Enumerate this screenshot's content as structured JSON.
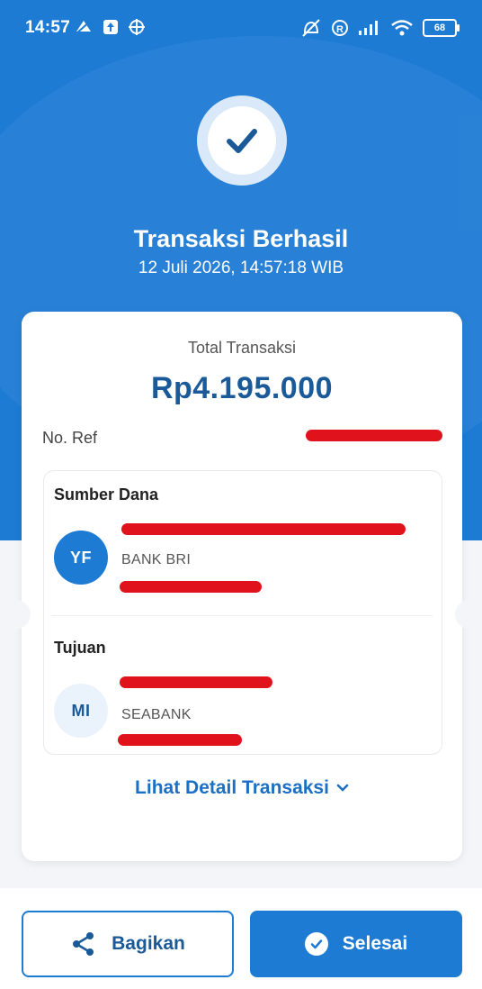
{
  "status_bar": {
    "time": "14:57",
    "battery": "68",
    "left_icons": [
      "notification-mute-icon",
      "upload-icon",
      "vpn-icon"
    ],
    "right_icons": [
      "mute-icon",
      "registered-icon",
      "signal-icon",
      "wifi-icon",
      "battery-icon"
    ]
  },
  "header": {
    "title": "Transaksi Berhasil",
    "datetime": "12 Juli 2026, 14:57:18 WIB",
    "icon": "check-icon"
  },
  "receipt": {
    "total_label": "Total Transaksi",
    "total_amount": "Rp4.195.000",
    "ref_label": "No. Ref",
    "source": {
      "heading": "Sumber Dana",
      "initials": "YF",
      "bank": "BANK BRI"
    },
    "destination": {
      "heading": "Tujuan",
      "initials": "MI",
      "bank": "SEABANK"
    },
    "detail_link": "Lihat Detail Transaksi"
  },
  "footer": {
    "share_label": "Bagikan",
    "done_label": "Selesai"
  },
  "colors": {
    "primary": "#1d7bd4",
    "amount": "#1b5a99",
    "redaction": "#e0121b"
  }
}
